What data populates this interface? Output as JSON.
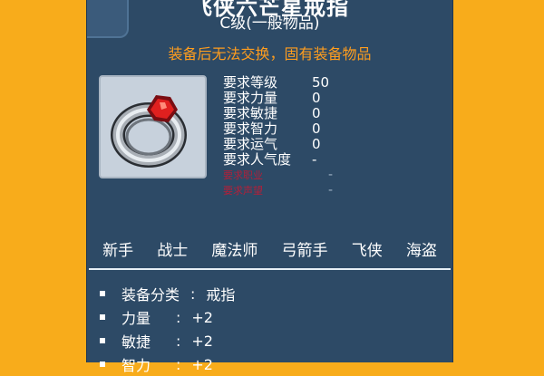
{
  "item": {
    "name": "飞侠六芒星戒指",
    "grade": "C级(一般物品)",
    "notice": "装备后无法交换，固有装备物品"
  },
  "requirements": [
    {
      "label": "要求等级",
      "value": "50"
    },
    {
      "label": "要求力量",
      "value": "0"
    },
    {
      "label": "要求敏捷",
      "value": "0"
    },
    {
      "label": "要求智力",
      "value": "0"
    },
    {
      "label": "要求运气",
      "value": "0"
    },
    {
      "label": "要求人气度",
      "value": "-"
    }
  ],
  "disabled_requirements": [
    {
      "label": "要求职业",
      "value": "-"
    },
    {
      "label": "要求声望",
      "value": "-"
    }
  ],
  "jobs": [
    "新手",
    "战士",
    "魔法师",
    "弓箭手",
    "飞侠",
    "海盗"
  ],
  "stats": [
    {
      "label": "装备分类",
      "sep": ":",
      "value": "戒指"
    },
    {
      "label": "力量",
      "sep": ":",
      "value": "+2"
    },
    {
      "label": "敏捷",
      "sep": ":",
      "value": "+2"
    },
    {
      "label": "智力",
      "sep": ":",
      "value": "+2"
    }
  ],
  "icon": "ring-icon",
  "colors": {
    "background": "#f8ac1b",
    "panel": "#2d4a66",
    "notice": "#ff9d1e",
    "disabled": "#b0203a"
  }
}
